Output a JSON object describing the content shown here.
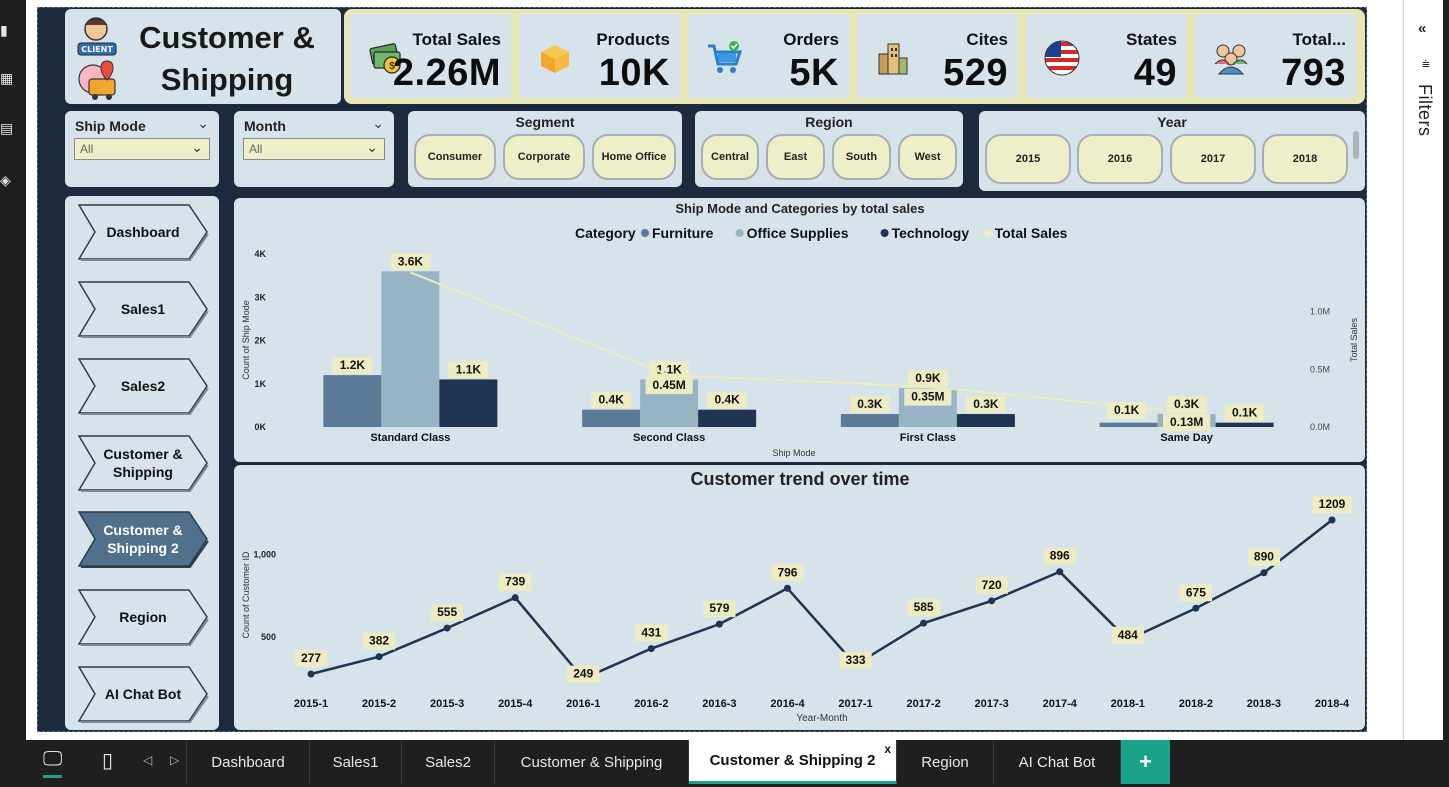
{
  "title": {
    "line1": "Customer &",
    "line2": "Shipping",
    "client_badge": "CLIENT"
  },
  "kpis": [
    {
      "label": "Total Sales",
      "value": "2.26M",
      "icon": "money-icon"
    },
    {
      "label": "Products",
      "value": "10K",
      "icon": "box-icon"
    },
    {
      "label": "Orders",
      "value": "5K",
      "icon": "cart-icon"
    },
    {
      "label": "Cites",
      "value": "529",
      "icon": "city-icon"
    },
    {
      "label": "States",
      "value": "49",
      "icon": "us-flag-icon"
    },
    {
      "label": "Total...",
      "value": "793",
      "icon": "people-icon"
    }
  ],
  "slicers": {
    "ship_mode": {
      "label": "Ship Mode",
      "value": "All"
    },
    "month": {
      "label": "Month",
      "value": "All"
    },
    "segment": {
      "label": "Segment",
      "options": [
        "Consumer",
        "Corporate",
        "Home Office"
      ]
    },
    "region": {
      "label": "Region",
      "options": [
        "Central",
        "East",
        "South",
        "West"
      ]
    },
    "year": {
      "label": "Year",
      "options": [
        "2015",
        "2016",
        "2017",
        "2018"
      ]
    }
  },
  "nav": [
    {
      "label": "Dashboard",
      "active": false
    },
    {
      "label": "Sales1",
      "active": false
    },
    {
      "label": "Sales2",
      "active": false
    },
    {
      "label": "Customer &\nShipping",
      "active": false
    },
    {
      "label": "Customer &\nShipping 2",
      "active": true
    },
    {
      "label": "Region",
      "active": false
    },
    {
      "label": "AI Chat Bot",
      "active": false
    }
  ],
  "filters_pane": {
    "label": "Filters"
  },
  "tabs": {
    "items": [
      "Dashboard",
      "Sales1",
      "Sales2",
      "Customer & Shipping",
      "Customer & Shipping 2",
      "Region",
      "AI Chat Bot"
    ],
    "active": "Customer & Shipping 2",
    "close_label": "x",
    "add_label": "+"
  },
  "colors": {
    "furniture": "#5a7a98",
    "office_supplies": "#97b4c4",
    "technology": "#1f3450",
    "total_sales_line": "#ecebc2",
    "panel_bg": "#d7e3ea",
    "kpi_strip": "#e9e6b6",
    "accent_tab": "#1aa189"
  },
  "chart_data": [
    {
      "type": "bar",
      "title": "Ship Mode and Categories by total sales",
      "legend_title": "Category",
      "legend_position": "top",
      "xlabel": "Ship Mode",
      "ylabel": "Count of Ship Mode",
      "y2label": "Total Sales",
      "categories": [
        "Standard Class",
        "Second Class",
        "First Class",
        "Same Day"
      ],
      "series": [
        {
          "name": "Furniture",
          "values": [
            1200,
            400,
            300,
            100
          ],
          "labels": [
            "1.2K",
            "0.4K",
            "0.3K",
            ""
          ]
        },
        {
          "name": "Office Supplies",
          "values": [
            3600,
            1100,
            900,
            300
          ],
          "labels": [
            "3.6K",
            "1.1K",
            "0.9K",
            "0.3K"
          ]
        },
        {
          "name": "Technology",
          "values": [
            1100,
            400,
            300,
            100
          ],
          "labels": [
            "1.1K",
            "0.4K",
            "0.3K",
            "0.1K"
          ]
        }
      ],
      "line_series": {
        "name": "Total Sales",
        "values": [
          1.34,
          0.45,
          0.35,
          0.13
        ],
        "labels": [
          "",
          "0.45M",
          "0.35M",
          "0.13M"
        ],
        "extra_labels": [
          "",
          "",
          "",
          "0.1K"
        ]
      },
      "ylim": [
        0,
        4000
      ],
      "yticks": [
        "0K",
        "1K",
        "2K",
        "3K",
        "4K"
      ],
      "y2lim": [
        0,
        1.5
      ],
      "y2ticks": [
        "0.0M",
        "0.5M",
        "1.0M"
      ]
    },
    {
      "type": "line",
      "title": "Customer trend over time",
      "xlabel": "Year-Month",
      "ylabel": "Count of Customer ID",
      "categories": [
        "2015-1",
        "2015-2",
        "2015-3",
        "2015-4",
        "2016-1",
        "2016-2",
        "2016-3",
        "2016-4",
        "2017-1",
        "2017-2",
        "2017-3",
        "2017-4",
        "2018-1",
        "2018-2",
        "2018-3",
        "2018-4"
      ],
      "values": [
        277,
        382,
        555,
        739,
        249,
        431,
        579,
        796,
        333,
        585,
        720,
        896,
        484,
        675,
        890,
        1209
      ],
      "yticks": [
        "500",
        "1,000"
      ],
      "ylim": [
        150,
        1300
      ]
    }
  ]
}
